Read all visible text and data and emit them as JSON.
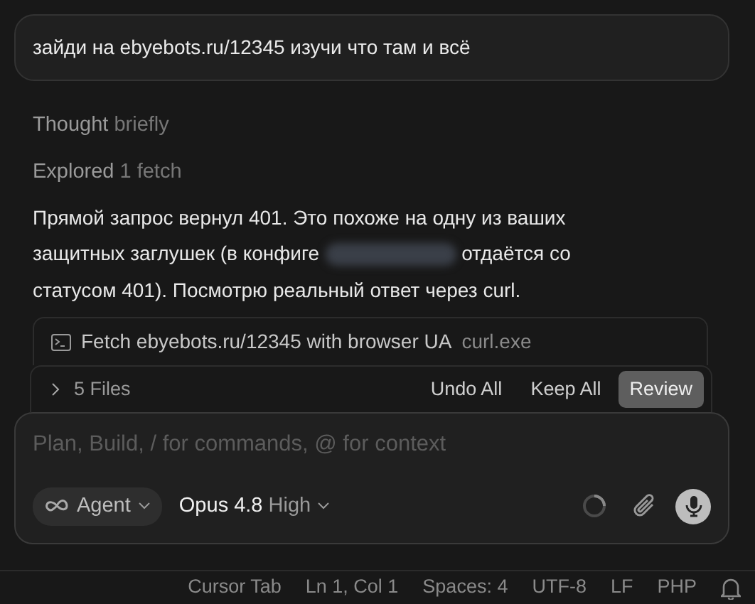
{
  "user_message": "зайди на ebyebots.ru/12345 изучи что там и всё",
  "activity": [
    {
      "label": "Thought",
      "detail": "briefly"
    },
    {
      "label": "Explored",
      "detail": "1 fetch"
    }
  ],
  "reply_lines": [
    {
      "text": "Прямой запрос вернул 401. Это похоже на одну из ваших"
    },
    {
      "before": "защитных заглушек (в конфиге",
      "after": "отдаётся со"
    },
    {
      "text": "статусом 401). Посмотрю реальный ответ через curl."
    }
  ],
  "tool_call": {
    "title": "Fetch ebyebots.ru/12345 with browser UA",
    "command": "curl.exe"
  },
  "changes": {
    "expanded": false,
    "count_label": "5 Files",
    "buttons": [
      {
        "label": "Undo All",
        "primary": false
      },
      {
        "label": "Keep All",
        "primary": false
      },
      {
        "label": "Review",
        "primary": true
      }
    ]
  },
  "composer": {
    "placeholder": "Plan, Build, / for commands, @ for context",
    "mode": "Agent",
    "model": "Opus 4.8",
    "effort": "High"
  },
  "status_bar": [
    "Cursor Tab",
    "Ln 1, Col 1",
    "Spaces: 4",
    "UTF-8",
    "LF",
    "PHP"
  ]
}
